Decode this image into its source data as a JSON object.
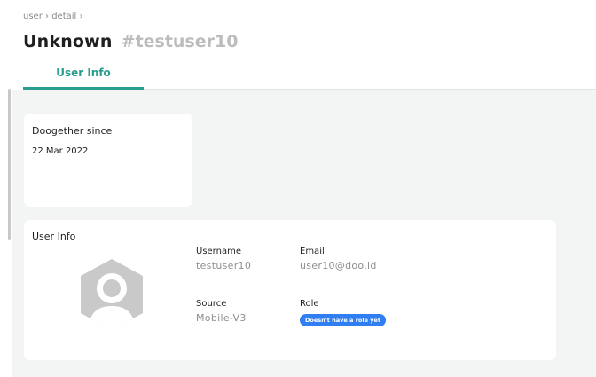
{
  "breadcrumb": {
    "items": [
      "user",
      "detail"
    ],
    "separator": "›"
  },
  "header": {
    "name": "Unknown",
    "user_id": "#testuser10"
  },
  "tabs": [
    {
      "label": "User Info",
      "active": true
    }
  ],
  "since_card": {
    "label": "Doogether since",
    "date": "22 Mar 2022"
  },
  "info_card": {
    "title": "User Info",
    "username_label": "Username",
    "username_value": "testuser10",
    "email_label": "Email",
    "email_value": "user10@doo.id",
    "source_label": "Source",
    "source_value": "Mobile-V3",
    "role_label": "Role",
    "role_badge": "Doesn't have a role yet"
  },
  "colors": {
    "accent": "#2a9d8f",
    "badge": "#2f7ef2",
    "background": "#f3f4f4"
  },
  "icons": {
    "avatar": "user-avatar-placeholder-icon"
  }
}
